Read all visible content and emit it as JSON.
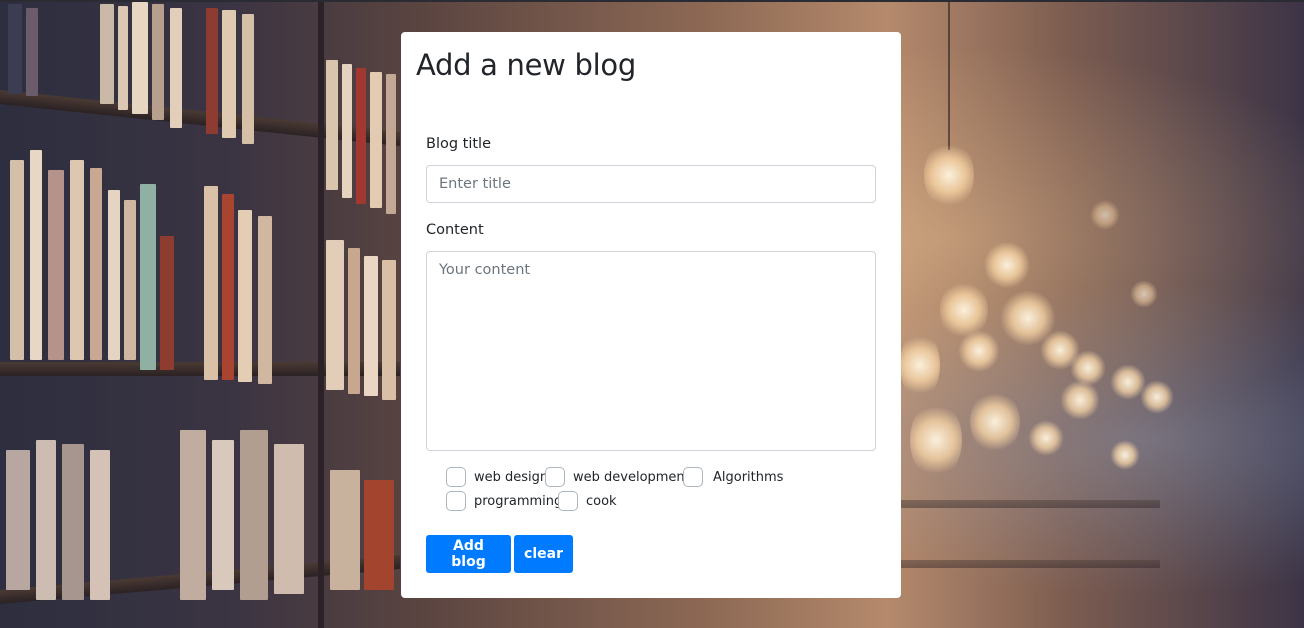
{
  "page": {
    "heading": "Add a new blog"
  },
  "form": {
    "title_label": "Blog title",
    "title_placeholder": "Enter title",
    "title_value": "",
    "content_label": "Content",
    "content_placeholder": "Your content",
    "content_value": ""
  },
  "tags": [
    {
      "label": "web design",
      "checked": false
    },
    {
      "label": "web development",
      "checked": false
    },
    {
      "label": "Algorithms",
      "checked": false
    },
    {
      "label": "programming",
      "checked": false
    },
    {
      "label": "cook",
      "checked": false
    }
  ],
  "buttons": {
    "add_label": "Add blog",
    "clear_label": "clear"
  },
  "colors": {
    "primary": "#007bff",
    "card_background": "#ffffff",
    "text": "#212529",
    "placeholder": "#6c757d",
    "border": "#ced4da"
  }
}
